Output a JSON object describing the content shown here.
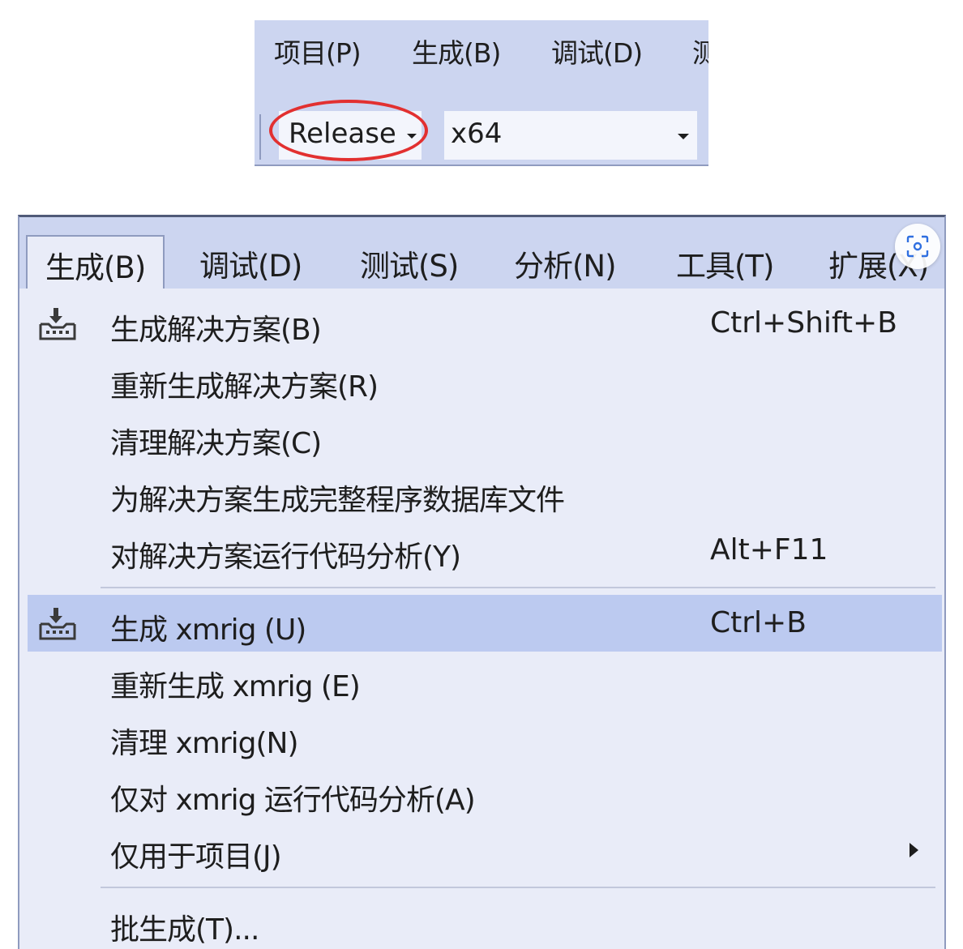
{
  "top_menubar": {
    "items": [
      {
        "label": "项目(P)"
      },
      {
        "label": "生成(B)"
      },
      {
        "label": "调试(D)"
      },
      {
        "label": "测"
      }
    ]
  },
  "toolbar": {
    "configuration": "Release",
    "platform": "x64"
  },
  "main_menubar": {
    "items": [
      {
        "label": "生成(B)",
        "active": true
      },
      {
        "label": "调试(D)"
      },
      {
        "label": "测试(S)"
      },
      {
        "label": "分析(N)"
      },
      {
        "label": "工具(T)"
      },
      {
        "label": "扩展(X)"
      }
    ]
  },
  "build_menu": {
    "items": [
      {
        "label": "生成解决方案(B)",
        "shortcut": "Ctrl+Shift+B",
        "icon": "build-icon"
      },
      {
        "label": "重新生成解决方案(R)",
        "shortcut": ""
      },
      {
        "label": "清理解决方案(C)",
        "shortcut": ""
      },
      {
        "label": "为解决方案生成完整程序数据库文件",
        "shortcut": ""
      },
      {
        "label": "对解决方案运行代码分析(Y)",
        "shortcut": "Alt+F11"
      },
      {
        "label": "生成 xmrig (U)",
        "shortcut": "Ctrl+B",
        "icon": "build-icon",
        "highlighted": true
      },
      {
        "label": "重新生成 xmrig (E)",
        "shortcut": ""
      },
      {
        "label": "清理 xmrig(N)",
        "shortcut": ""
      },
      {
        "label": "仅对 xmrig 运行代码分析(A)",
        "shortcut": ""
      },
      {
        "label": "仅用于项目(J)",
        "shortcut": "",
        "submenu": true
      },
      {
        "label": "批生成(T)...",
        "shortcut": ""
      }
    ]
  },
  "colors": {
    "menubar_bg": "#ccd5f0",
    "menu_bg": "#e9ecf8",
    "highlight_bg": "#bccaf0",
    "annotation_ring": "#e23030"
  }
}
